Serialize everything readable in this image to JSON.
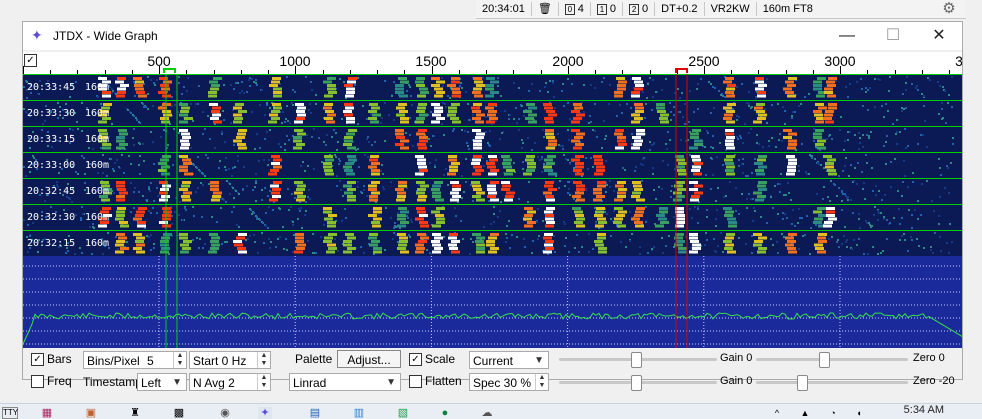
{
  "status_bar": {
    "time": "20:34:01",
    "trash_count": "",
    "box0_label": "0",
    "box0_count": "4",
    "box1_label": "1",
    "box1_count": "0",
    "box2_label": "2",
    "box2_count": "0",
    "dt": "DT+0.2",
    "callsign": "VR2KW",
    "band_mode": "160m FT8"
  },
  "window": {
    "title": "JTDX - Wide Graph",
    "minimize": "—",
    "maximize": "☐",
    "close": "✕"
  },
  "ruler": {
    "labels": [
      "500",
      "1000",
      "1500",
      "2000",
      "2500",
      "3000"
    ],
    "left_check": "✓",
    "right_edge": "3"
  },
  "waterfall_rows": [
    {
      "time": "20:33:45",
      "band": "160m"
    },
    {
      "time": "20:33:30",
      "band": "160m"
    },
    {
      "time": "20:33:15",
      "band": "160m"
    },
    {
      "time": "20:33:00",
      "band": "160m"
    },
    {
      "time": "20:32:45",
      "band": "160m"
    },
    {
      "time": "20:32:30",
      "band": "160m"
    },
    {
      "time": "20:32:15",
      "band": "160m"
    }
  ],
  "controls": {
    "bars_label": "Bars",
    "bars_checked": "✓",
    "freq_label": "Freq",
    "bins_label": "Bins/Pixel",
    "bins_value": "5",
    "start_value": "Start 0 Hz",
    "timestamp_label": "Timestamp",
    "timestamp_value": "Left",
    "navg_value": "N Avg 2",
    "palette_label": "Palette",
    "adjust_label": "Adjust...",
    "palette_value": "Linrad",
    "scale_checked": "✓",
    "scale_label": "Scale",
    "flatten_label": "Flatten",
    "current_value": "Current",
    "spec_value": "Spec 30 %",
    "gain_top": "Gain 0",
    "zero_top": "Zero 0",
    "gain_bottom": "Gain 0",
    "zero_bottom": "Zero -20",
    "gain_top_level": 0.49,
    "zero_top_level": 0.45,
    "gain_bottom_level": 0.49,
    "zero_bottom_level": 0.3
  },
  "taskbar": {
    "clock": "5:34 AM"
  },
  "colors": {
    "accent": "#5b4bd6",
    "waterfall_bg": "#0b1a55",
    "spectrum_bg": "#1a2a9a",
    "trace": "#37e14b",
    "cursor_green": "#00d000",
    "cursor_red": "#e00000"
  }
}
